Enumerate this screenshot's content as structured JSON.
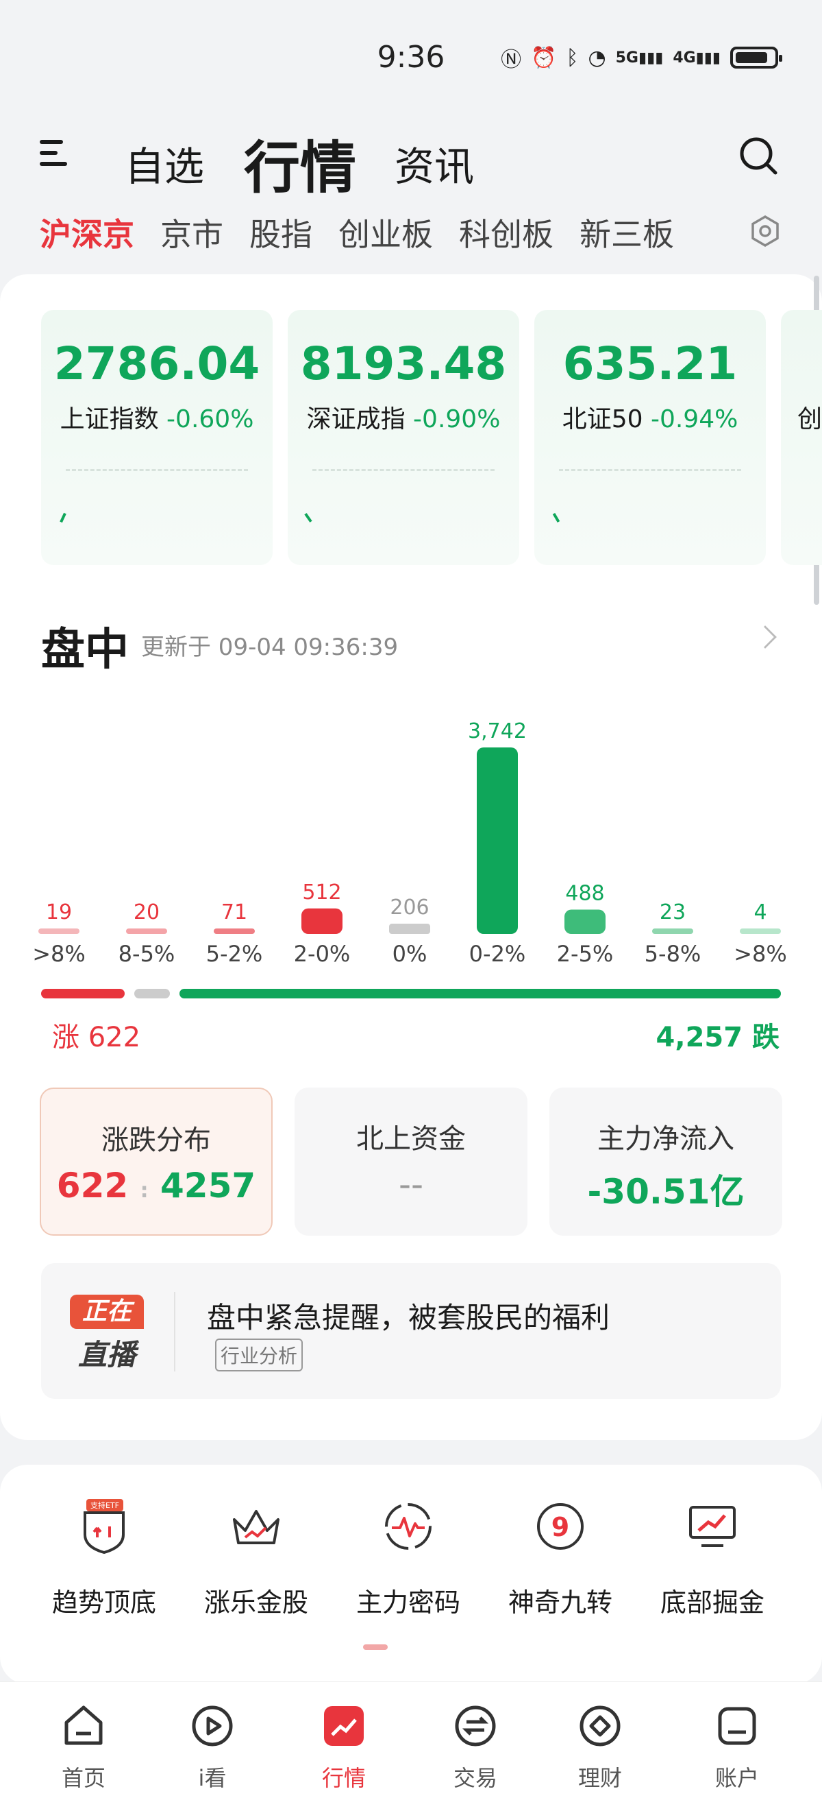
{
  "status": {
    "time": "9:36"
  },
  "header": {
    "tabs": [
      "自选",
      "行情",
      "资讯"
    ],
    "active_tab": "行情"
  },
  "sub_tabs": [
    "沪深京",
    "京市",
    "股指",
    "创业板",
    "科创板",
    "新三板"
  ],
  "indices": [
    {
      "value": "2786.04",
      "name": "上证指数",
      "change": "-0.60%"
    },
    {
      "value": "8193.48",
      "name": "深证成指",
      "change": "-0.90%"
    },
    {
      "value": "635.21",
      "name": "北证50",
      "change": "-0.94%"
    },
    {
      "value": "",
      "name": "创",
      "change": ""
    }
  ],
  "market": {
    "title": "盘中",
    "updated": "更新于 09-04 09:36:39",
    "up_label": "涨 622",
    "down_label": "4,257 跌"
  },
  "chart_data": {
    "type": "bar",
    "categories": [
      ">8%",
      "8-5%",
      "5-2%",
      "2-0%",
      "0%",
      "0-2%",
      "2-5%",
      "5-8%",
      ">8%"
    ],
    "values": [
      19,
      20,
      71,
      512,
      206,
      3742,
      488,
      23,
      4
    ],
    "value_labels": [
      "19",
      "20",
      "71",
      "512",
      "206",
      "3,742",
      "488",
      "23",
      "4"
    ],
    "colors": [
      "#f4b6b9",
      "#f4a4a8",
      "#ef7e84",
      "#e8353d",
      "#cccccc",
      "#0fa65a",
      "#3ebc7a",
      "#8fd6ae",
      "#b7e6cb"
    ],
    "label_colors": [
      "#e8353d",
      "#e8353d",
      "#e8353d",
      "#e8353d",
      "#999999",
      "#0fa65a",
      "#0fa65a",
      "#0fa65a",
      "#0fa65a"
    ],
    "title": "",
    "xlabel": "",
    "ylabel": ""
  },
  "stats": [
    {
      "title": "涨跌分布",
      "up": "622",
      "sep": ":",
      "down": "4257"
    },
    {
      "title": "北上资金",
      "value": "--"
    },
    {
      "title": "主力净流入",
      "value": "-30.51亿"
    }
  ],
  "live": {
    "logo_top": "正在",
    "logo_bottom": "直播",
    "title": "盘中紧急提醒，被套股民的福利",
    "tag": "行业分析"
  },
  "tools": [
    {
      "label": "趋势顶底",
      "icon": "shield-etf-icon",
      "badge": "支持ETF"
    },
    {
      "label": "涨乐金股",
      "icon": "crown-icon"
    },
    {
      "label": "主力密码",
      "icon": "pulse-circle-icon"
    },
    {
      "label": "神奇九转",
      "icon": "nine-circle-icon"
    },
    {
      "label": "底部掘金",
      "icon": "monitor-chart-icon"
    }
  ],
  "nav": [
    {
      "label": "首页",
      "icon": "home-icon"
    },
    {
      "label": "i看",
      "icon": "play-icon"
    },
    {
      "label": "行情",
      "icon": "market-icon"
    },
    {
      "label": "交易",
      "icon": "exchange-icon"
    },
    {
      "label": "理财",
      "icon": "finance-icon"
    },
    {
      "label": "账户",
      "icon": "account-icon"
    }
  ],
  "nav_active": "行情"
}
